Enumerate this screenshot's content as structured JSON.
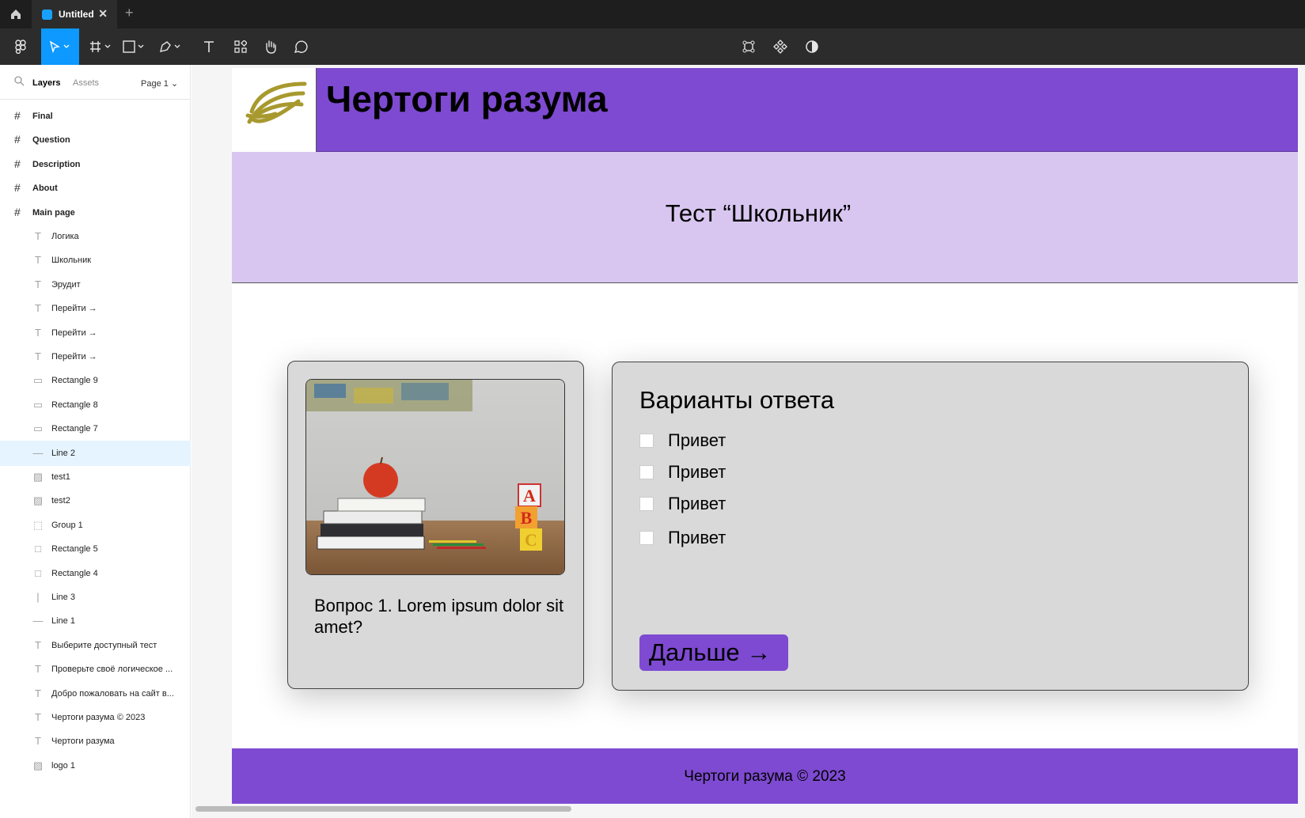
{
  "tabbar": {
    "tab_title": "Untitled",
    "close_glyph": "✕",
    "add_glyph": "+"
  },
  "toolbar": {
    "tools": [
      "main-menu-icon",
      "move-tool-icon",
      "frame-tool-icon",
      "shape-tool-icon",
      "pen-tool-icon",
      "text-tool-icon",
      "resources-icon",
      "hand-tool-icon",
      "comment-icon"
    ],
    "center_tools": [
      "crop-icon",
      "component-icon",
      "contrast-icon"
    ],
    "accent": "#0d99ff"
  },
  "panel": {
    "layers_tab": "Layers",
    "assets_tab": "Assets",
    "page_select": "Page 1 ⌄"
  },
  "layers": [
    {
      "name": "Final",
      "type": "frame"
    },
    {
      "name": "Question",
      "type": "frame"
    },
    {
      "name": "Description",
      "type": "frame"
    },
    {
      "name": "About",
      "type": "frame"
    },
    {
      "name": "Main page",
      "type": "frame"
    },
    {
      "name": "Логика",
      "type": "text"
    },
    {
      "name": "Школьник",
      "type": "text"
    },
    {
      "name": "Эрудит",
      "type": "text"
    },
    {
      "name": "Перейти →",
      "type": "text"
    },
    {
      "name": "Перейти →",
      "type": "text"
    },
    {
      "name": "Перейти →",
      "type": "text"
    },
    {
      "name": "Rectangle 9",
      "type": "rect-thin"
    },
    {
      "name": "Rectangle 8",
      "type": "rect-thin"
    },
    {
      "name": "Rectangle 7",
      "type": "rect-thin"
    },
    {
      "name": "Line 2",
      "type": "line",
      "selected": true
    },
    {
      "name": "test1",
      "type": "image"
    },
    {
      "name": "test2",
      "type": "image"
    },
    {
      "name": "Group 1",
      "type": "group"
    },
    {
      "name": "Rectangle 5",
      "type": "rect"
    },
    {
      "name": "Rectangle 4",
      "type": "rect"
    },
    {
      "name": "Line 3",
      "type": "vline"
    },
    {
      "name": "Line 1",
      "type": "line"
    },
    {
      "name": "Выберите доступный тест",
      "type": "text"
    },
    {
      "name": "Проверьте своё логическое ...",
      "type": "text"
    },
    {
      "name": "Добро пожаловать на сайт в...",
      "type": "text"
    },
    {
      "name": "Чертоги разума © 2023",
      "type": "text"
    },
    {
      "name": "Чертоги разума",
      "type": "text"
    },
    {
      "name": "logo 1",
      "type": "image"
    }
  ],
  "site": {
    "title": "Чертоги разума",
    "test_title": "Тест “Школьник”",
    "question": "Вопрос 1. Lorem ipsum dolor sit amet?",
    "answers_title": "Варианты ответа",
    "answers": [
      "Привет",
      "Привет",
      "Привет",
      "Привет"
    ],
    "next_button": "Дальше →",
    "footer": "Чертоги разума © 2023",
    "purple": "#7e4ad1",
    "lavender": "#d8c6f0"
  }
}
